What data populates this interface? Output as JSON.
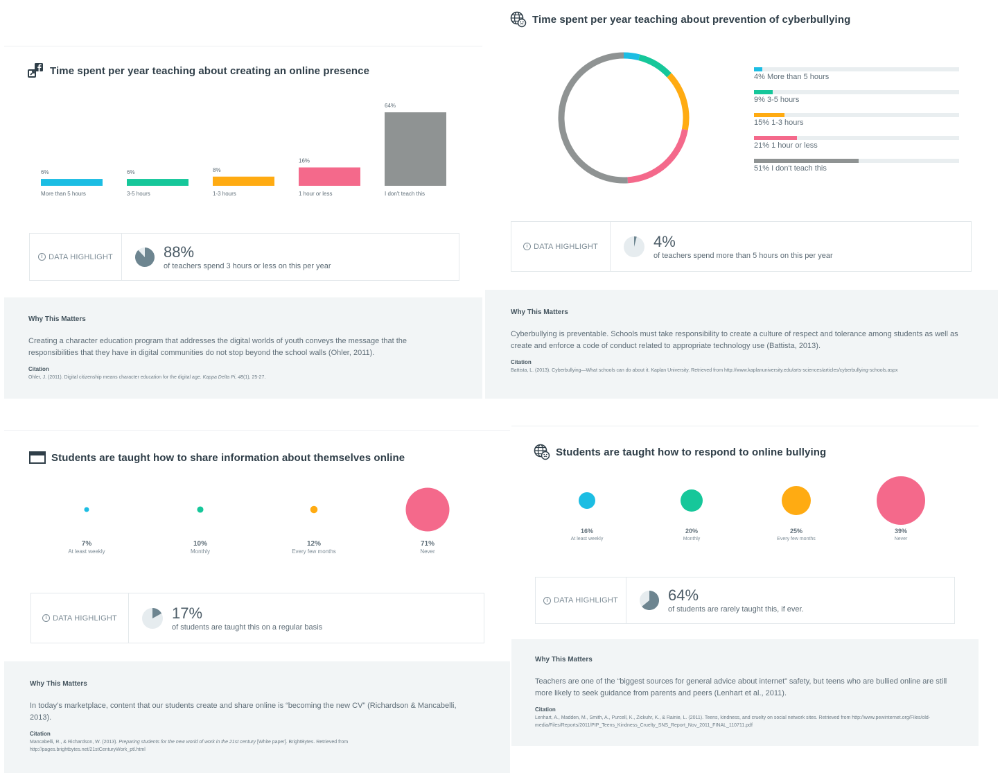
{
  "panel1": {
    "title": "Time spent per year teaching about creating an online presence",
    "chart_data": {
      "type": "bar",
      "title": "Time spent per year teaching about creating an online presence",
      "categories": [
        "More than 5 hours",
        "3-5 hours",
        "1-3 hours",
        "1 hour or less",
        "I don't teach this"
      ],
      "values": [
        6,
        6,
        8,
        16,
        64
      ],
      "value_labels": [
        "6%",
        "6%",
        "8%",
        "16%",
        "64%"
      ],
      "colors": [
        "#1cbde3",
        "#16c79a",
        "#ffab12",
        "#f4698b",
        "#8f9393"
      ],
      "ylim": [
        0,
        64
      ],
      "grid": false
    },
    "highlight": {
      "label": "DATA HIGHLIGHT",
      "pct": "88%",
      "pct_value": 88,
      "text": "of teachers spend 3 hours or less on this per year"
    },
    "why": {
      "heading": "Why This Matters",
      "body": "Creating a character education program that addresses the digital worlds of youth conveys the message that the responsibilities that they have in digital communities do not stop beyond the school walls (Ohler, 2011).",
      "citation_label": "Citation",
      "citation_pre": "Ohler, J. (2011). Digital citizenship means character education for the digital age. ",
      "citation_italic": "Kappa Delta Pi, 48",
      "citation_post": "(1), 25-27."
    }
  },
  "panel2": {
    "title": "Time spent per year teaching about prevention of cyberbullying",
    "chart_data": {
      "type": "pie",
      "title": "Time spent per year teaching about prevention of cyberbullying",
      "categories": [
        "More than 5 hours",
        "3-5 hours",
        "1-3 hours",
        "1 hour or less",
        "I don't teach this"
      ],
      "values": [
        4,
        9,
        15,
        21,
        51
      ],
      "value_labels": [
        "4%",
        "9%",
        "15%",
        "21%",
        "51%"
      ],
      "colors": [
        "#1cbde3",
        "#16c79a",
        "#ffab12",
        "#f4698b",
        "#8f9393"
      ]
    },
    "highlight": {
      "label": "DATA HIGHLIGHT",
      "pct": "4%",
      "pct_value": 4,
      "text": "of teachers spend more than 5 hours on this per year"
    },
    "why": {
      "heading": "Why This Matters",
      "body": "Cyberbullying is preventable. Schools must take responsibility to create a culture of respect and tolerance among students as well as create and enforce a code of conduct related to appropriate technology use (Battista, 2013).",
      "citation_label": "Citation",
      "citation": "Battista, L. (2013). Cyberbullying—What schools can do about it. Kaplan University. Retrieved from http://www.kaplanuniversity.edu/arts-sciences/articles/cyberbullying-schools.aspx"
    }
  },
  "panel3": {
    "title": "Students are taught how to share information about themselves online",
    "chart_data": {
      "type": "scatter",
      "title": "Students are taught how to share information about themselves online",
      "categories": [
        "At least weekly",
        "Monthly",
        "Every few months",
        "Never"
      ],
      "values": [
        7,
        10,
        12,
        71
      ],
      "value_labels": [
        "7%",
        "10%",
        "12%",
        "71%"
      ],
      "colors": [
        "#1cbde3",
        "#16c79a",
        "#ffab12",
        "#f4698b"
      ]
    },
    "highlight": {
      "label": "DATA HIGHLIGHT",
      "pct": "17%",
      "pct_value": 17,
      "text": "of students are taught this on a regular basis"
    },
    "why": {
      "heading": "Why This Matters",
      "body": "In today’s marketplace, content that our students create and share online is “becoming the new CV” (Richardson & Mancabelli, 2013).",
      "citation_label": "Citation",
      "citation_pre": "Mancabelli, R., & Richardson, W. (2013). ",
      "citation_italic": "Preparing students for the new world of work in the 21st century",
      "citation_post": " [White paper]. BrightBytes. Retrieved from",
      "citation_line2": "http://pages.brightbytes.net/21stCenturyWork_ptl.html"
    }
  },
  "panel4": {
    "title": "Students are taught how to respond to online bullying",
    "chart_data": {
      "type": "scatter",
      "title": "Students are taught how to respond to online bullying",
      "categories": [
        "At least weekly",
        "Monthly",
        "Every few months",
        "Never"
      ],
      "values": [
        16,
        20,
        25,
        39
      ],
      "value_labels": [
        "16%",
        "20%",
        "25%",
        "39%"
      ],
      "colors": [
        "#1cbde3",
        "#16c79a",
        "#ffab12",
        "#f4698b"
      ]
    },
    "highlight": {
      "label": "DATA HIGHLIGHT",
      "pct": "64%",
      "pct_value": 64,
      "text": "of students are rarely taught this, if ever."
    },
    "why": {
      "heading": "Why This Matters",
      "body": "Teachers are one of the “biggest sources for general advice about internet” safety, but teens who are bullied online are still more likely to seek guidance from parents and peers (Lenhart et al., 2011).",
      "citation_label": "Citation",
      "citation": "Lenhart, A., Madden, M., Smith, A., Purcell, K., Zickuhr, K., & Rainie, L. (2011). Teens, kindness, and cruelty on social network sites. Retrieved from http://www.pewinternet.org/Files/old-media/Files/Reports/2011/PIP_Teens_Kindness_Cruelty_SNS_Report_Nov_2011_FINAL_110711.pdf"
    }
  }
}
